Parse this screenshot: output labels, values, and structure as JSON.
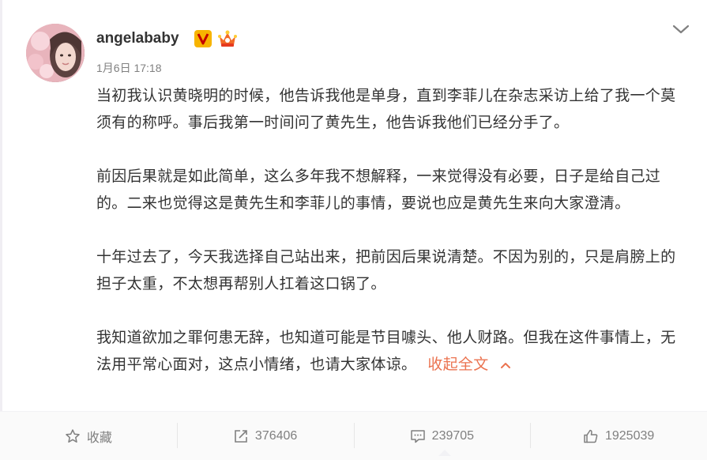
{
  "post": {
    "username": "angelababy",
    "timestamp": "1月6日 17:18",
    "paragraphs": [
      "当初我认识黄晓明的时候，他告诉我他是单身，直到李菲儿在杂志采访上给了我一个莫须有的称呼。事后我第一时间问了黄先生，他告诉我他们已经分手了。",
      "前因后果就是如此简单，这么多年我不想解释，一来觉得没有必要，日子是给自己过的。二来也觉得这是黄先生和李菲儿的事情，要说也应是黄先生来向大家澄清。",
      "十年过去了，今天我选择自己站出来，把前因后果说清楚。不因为别的，只是肩膀上的担子太重，不太想再帮别人扛着这口锅了。",
      "我知道欲加之罪何患无辞，也知道可能是节目噱头、他人财路。但我在这件事情上，无法用平常心面对，这点小情绪，也请大家体谅。"
    ],
    "collapse_label": "收起全文"
  },
  "actions": {
    "favorite_label": "收藏",
    "repost_count": "376406",
    "comment_count": "239705",
    "like_count": "1925039"
  },
  "colors": {
    "link": "#eb7350",
    "muted": "#808080",
    "text": "#333333"
  },
  "icons": {
    "verified": "verified-v-badge-icon",
    "vip": "crown-vip-icon",
    "menu": "chevron-down-icon",
    "favorite": "star-icon",
    "repost": "repost-icon",
    "comment": "comment-icon",
    "like": "thumbs-up-icon"
  }
}
